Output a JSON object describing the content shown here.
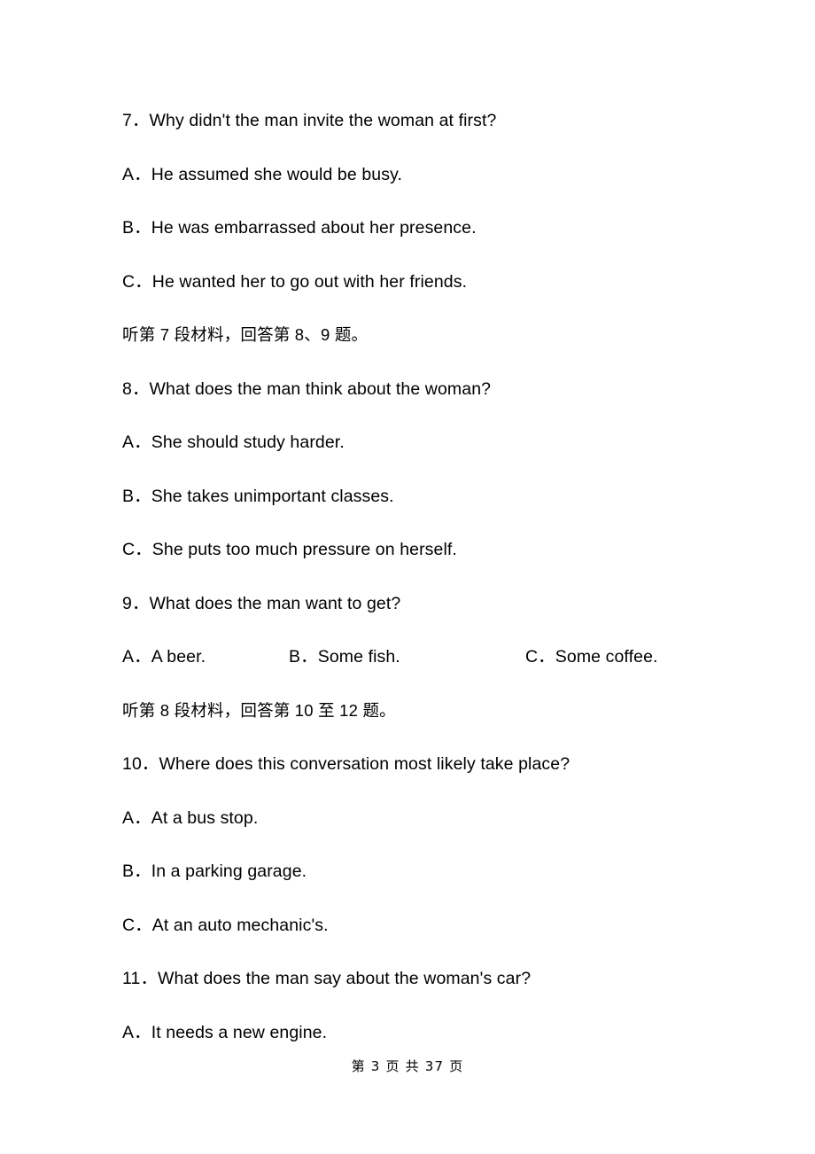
{
  "document": {
    "type": "listening-comprehension-exam",
    "lines": [
      {
        "kind": "question",
        "text": "7．Why didn't the man invite the woman at first?"
      },
      {
        "kind": "option",
        "text": "A．He assumed she would be busy."
      },
      {
        "kind": "option",
        "text": "B．He was embarrassed about her presence."
      },
      {
        "kind": "option",
        "text": "C．He wanted her to go out with her friends."
      },
      {
        "kind": "directive",
        "text": "听第 7 段材料，回答第 8、9 题。"
      },
      {
        "kind": "question",
        "text": "8．What does the man think about the woman?"
      },
      {
        "kind": "option",
        "text": "A．She should study harder."
      },
      {
        "kind": "option",
        "text": "B．She takes unimportant classes."
      },
      {
        "kind": "option",
        "text": "C．She puts too much pressure on herself."
      },
      {
        "kind": "question",
        "text": "9．What does the man want to get?"
      },
      {
        "kind": "option-row"
      },
      {
        "kind": "directive",
        "text": "听第 8 段材料，回答第 10 至 12 题。"
      },
      {
        "kind": "question",
        "text": "10．Where does this conversation most likely take place?"
      },
      {
        "kind": "option",
        "text": "A．At a bus stop."
      },
      {
        "kind": "option",
        "text": "B．In a parking garage."
      },
      {
        "kind": "option",
        "text": "C．At an auto mechanic's."
      },
      {
        "kind": "question",
        "text": "11．What does the man say about the woman's car?"
      },
      {
        "kind": "option",
        "text": "A．It needs a new engine."
      }
    ],
    "q9_inline_options": {
      "a": "A．A beer.",
      "b": "B．Some fish.",
      "c": "C．Some coffee."
    },
    "footer": {
      "text": "第 3 页 共 37 页",
      "current_page": "3",
      "total_pages": "37"
    }
  }
}
